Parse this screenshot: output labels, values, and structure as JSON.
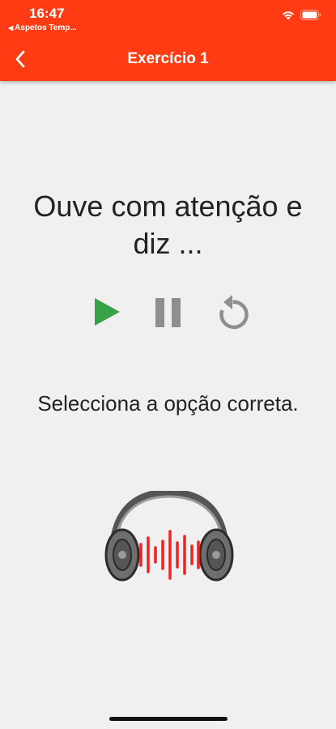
{
  "status_bar": {
    "time": "16:47",
    "back_app": "Aspetos Temp...",
    "icons": [
      "wifi-icon",
      "battery-icon"
    ]
  },
  "header": {
    "title": "Exercício 1",
    "back_icon": "chevron-left-icon",
    "color": "#fe3b13"
  },
  "exercise": {
    "prompt": "Ouve com atenção e diz ...",
    "controls": [
      "play-icon",
      "pause-icon",
      "replay-icon"
    ],
    "instruction": "Selecciona a opção correta.",
    "image": "headphones-icon"
  }
}
